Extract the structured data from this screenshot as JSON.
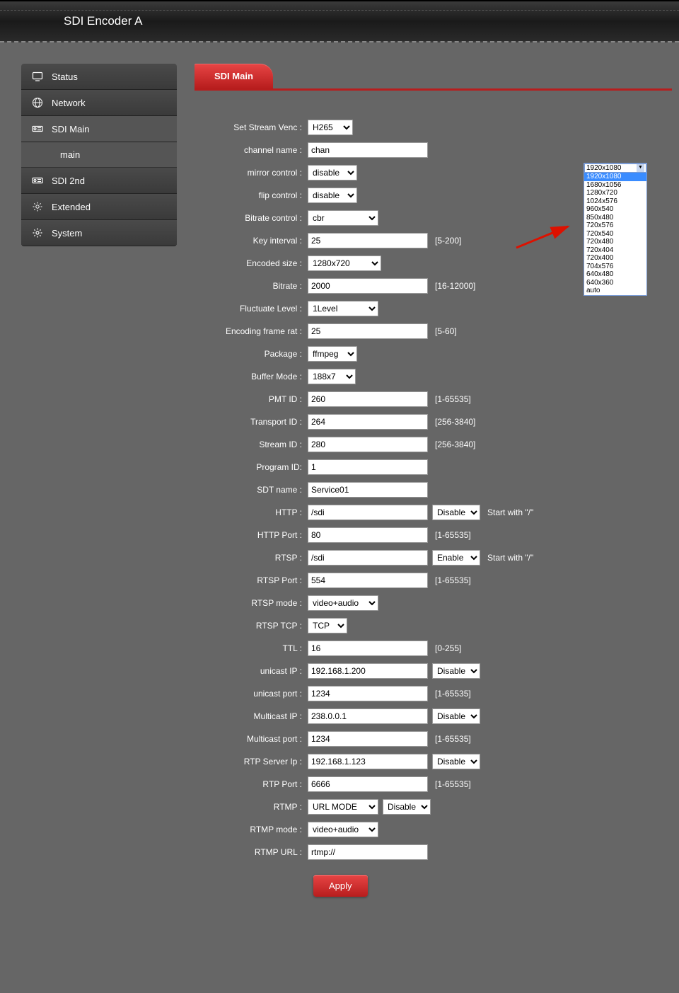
{
  "header": {
    "title": "SDI Encoder  A"
  },
  "sidebar": {
    "items": [
      {
        "id": "status",
        "label": "Status"
      },
      {
        "id": "network",
        "label": "Network"
      },
      {
        "id": "sdi-main",
        "label": "SDI Main",
        "active": true,
        "sub": [
          {
            "label": "main"
          }
        ]
      },
      {
        "id": "sdi-2nd",
        "label": "SDI 2nd"
      },
      {
        "id": "extended",
        "label": "Extended"
      },
      {
        "id": "system",
        "label": "System"
      }
    ]
  },
  "tab": {
    "title": "SDI Main"
  },
  "form": {
    "stream_venc": {
      "label": "Set Stream Venc :",
      "value": "H265"
    },
    "channel_name": {
      "label": "channel name :",
      "value": "chan"
    },
    "mirror_control": {
      "label": "mirror control :",
      "value": "disable"
    },
    "flip_control": {
      "label": "flip control :",
      "value": "disable"
    },
    "bitrate_control": {
      "label": "Bitrate control :",
      "value": "cbr"
    },
    "key_interval": {
      "label": "Key interval :",
      "value": "25",
      "hint": "[5-200]"
    },
    "encoded_size": {
      "label": "Encoded size :",
      "value": "1280x720"
    },
    "bitrate": {
      "label": "Bitrate :",
      "value": "2000",
      "hint": "[16-12000]"
    },
    "fluctuate": {
      "label": "Fluctuate Level :",
      "value": "1Level"
    },
    "frame_rate": {
      "label": "Encoding frame rat :",
      "value": "25",
      "hint": "[5-60]"
    },
    "package": {
      "label": "Package :",
      "value": "ffmpeg"
    },
    "buffer_mode": {
      "label": "Buffer Mode :",
      "value": "188x7"
    },
    "pmt_id": {
      "label": "PMT ID :",
      "value": "260",
      "hint": "[1-65535]"
    },
    "transport_id": {
      "label": "Transport ID :",
      "value": "264",
      "hint": "[256-3840]"
    },
    "stream_id": {
      "label": "Stream ID :",
      "value": "280",
      "hint": "[256-3840]"
    },
    "program_id": {
      "label": "Program ID:",
      "value": "1"
    },
    "sdt_name": {
      "label": "SDT name :",
      "value": "Service01"
    },
    "http": {
      "label": "HTTP :",
      "value": "/sdi",
      "state": "Disable",
      "note": "Start with \"/\""
    },
    "http_port": {
      "label": "HTTP Port :",
      "value": "80",
      "hint": "[1-65535]"
    },
    "rtsp": {
      "label": "RTSP :",
      "value": "/sdi",
      "state": "Enable",
      "note": "Start with \"/\""
    },
    "rtsp_port": {
      "label": "RTSP Port :",
      "value": "554",
      "hint": "[1-65535]"
    },
    "rtsp_mode": {
      "label": "RTSP mode :",
      "value": "video+audio"
    },
    "rtsp_tcp": {
      "label": "RTSP TCP :",
      "value": "TCP"
    },
    "ttl": {
      "label": "TTL :",
      "value": "16",
      "hint": "[0-255]"
    },
    "unicast_ip": {
      "label": "unicast IP :",
      "value": "192.168.1.200",
      "state": "Disable"
    },
    "unicast_port": {
      "label": "unicast port :",
      "value": "1234",
      "hint": "[1-65535]"
    },
    "multicast_ip": {
      "label": "Multicast IP :",
      "value": "238.0.0.1",
      "state": "Disable"
    },
    "multicast_port": {
      "label": "Multicast port :",
      "value": "1234",
      "hint": "[1-65535]"
    },
    "rtp_server_ip": {
      "label": "RTP Server Ip :",
      "value": "192.168.1.123",
      "state": "Disable"
    },
    "rtp_port": {
      "label": "RTP Port :",
      "value": "6666",
      "hint": "[1-65535]"
    },
    "rtmp": {
      "label": "RTMP :",
      "value": "URL MODE",
      "state": "Disable"
    },
    "rtmp_mode": {
      "label": "RTMP mode :",
      "value": "video+audio"
    },
    "rtmp_url": {
      "label": "RTMP URL :",
      "value": "rtmp://"
    }
  },
  "apply_label": "Apply",
  "size_dropdown": {
    "selected": "1920x1080",
    "highlighted": "1920x1080",
    "options": [
      "1920x1080",
      "1680x1056",
      "1280x720",
      "1024x576",
      "960x540",
      "850x480",
      "720x576",
      "720x540",
      "720x480",
      "720x404",
      "720x400",
      "704x576",
      "640x480",
      "640x360",
      "auto"
    ]
  }
}
